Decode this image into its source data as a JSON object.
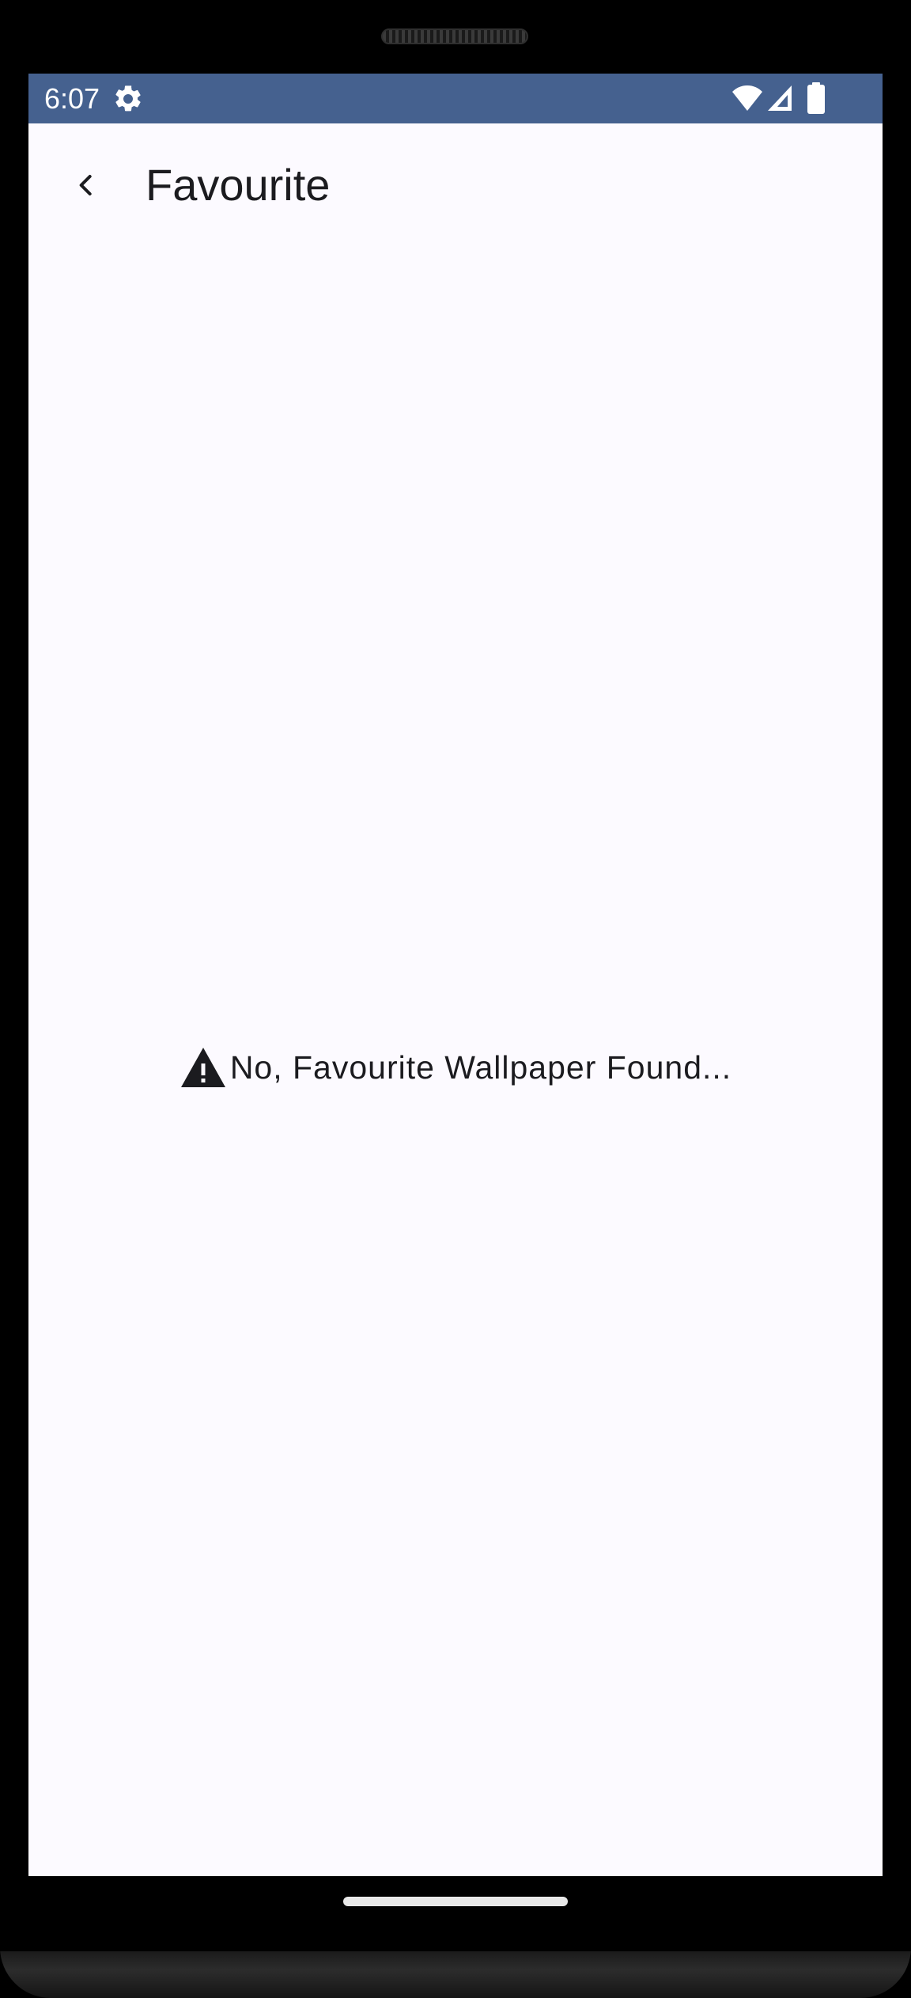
{
  "status_bar": {
    "time": "6:07",
    "icons": [
      "settings-icon",
      "wifi-icon",
      "signal-icon",
      "battery-icon"
    ],
    "background_color": "#45618f"
  },
  "app_bar": {
    "back_icon": "chevron-left-icon",
    "title": "Favourite"
  },
  "empty_state": {
    "icon": "warning-icon",
    "message": "No, Favourite Wallpaper Found..."
  },
  "colors": {
    "screen_background": "#fcfaff",
    "text_primary": "#1b1b1f"
  }
}
